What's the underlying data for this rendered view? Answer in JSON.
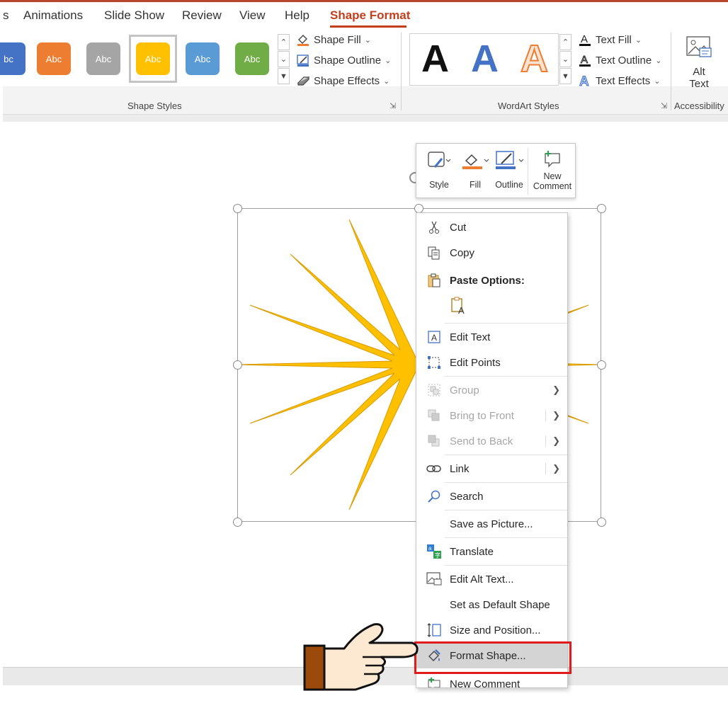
{
  "tabs": [
    {
      "label": "s"
    },
    {
      "label": "Animations"
    },
    {
      "label": "Slide Show"
    },
    {
      "label": "Review"
    },
    {
      "label": "View"
    },
    {
      "label": "Help"
    },
    {
      "label": "Shape Format",
      "active": true
    }
  ],
  "shape_styles": {
    "gallery": [
      {
        "label": "bc",
        "color": "#4472c4"
      },
      {
        "label": "Abc",
        "color": "#ed7d31"
      },
      {
        "label": "Abc",
        "color": "#a5a5a5"
      },
      {
        "label": "Abc",
        "color": "#ffc000",
        "selected": true
      },
      {
        "label": "Abc",
        "color": "#5b9bd5"
      },
      {
        "label": "Abc",
        "color": "#70ad47"
      }
    ],
    "shape_fill": "Shape Fill",
    "shape_outline": "Shape Outline",
    "shape_effects": "Shape Effects",
    "group_label": "Shape Styles"
  },
  "wordart_styles": {
    "samples": [
      {
        "label": "A",
        "color": "#000000"
      },
      {
        "label": "A",
        "color": "#4472c4"
      },
      {
        "label": "A",
        "color": "#f4b183"
      }
    ],
    "text_fill": "Text Fill",
    "text_outline": "Text Outline",
    "text_effects": "Text Effects",
    "group_label": "WordArt Styles"
  },
  "accessibility": {
    "alt_text_line1": "Alt",
    "alt_text_line2": "Text",
    "group_label": "Accessibility"
  },
  "mini_toolbar": {
    "style": "Style",
    "fill": "Fill",
    "outline": "Outline",
    "new_comment_line1": "New",
    "new_comment_line2": "Comment"
  },
  "context_menu": {
    "cut": "Cut",
    "copy": "Copy",
    "paste_options": "Paste Options:",
    "edit_text": "Edit Text",
    "edit_points": "Edit Points",
    "group": "Group",
    "bring_to_front": "Bring to Front",
    "send_to_back": "Send to Back",
    "link": "Link",
    "search": "Search",
    "save_as_picture": "Save as Picture...",
    "translate": "Translate",
    "edit_alt_text": "Edit Alt Text...",
    "set_default_shape": "Set as Default Shape",
    "size_and_position": "Size and Position...",
    "format_shape": "Format Shape...",
    "new_comment": "New Comment"
  },
  "colors": {
    "accent": "#c43e1c",
    "shape_fill": "#ffc000",
    "highlight_box": "#e01b1b",
    "hand_cuff": "#9c4a0c"
  }
}
